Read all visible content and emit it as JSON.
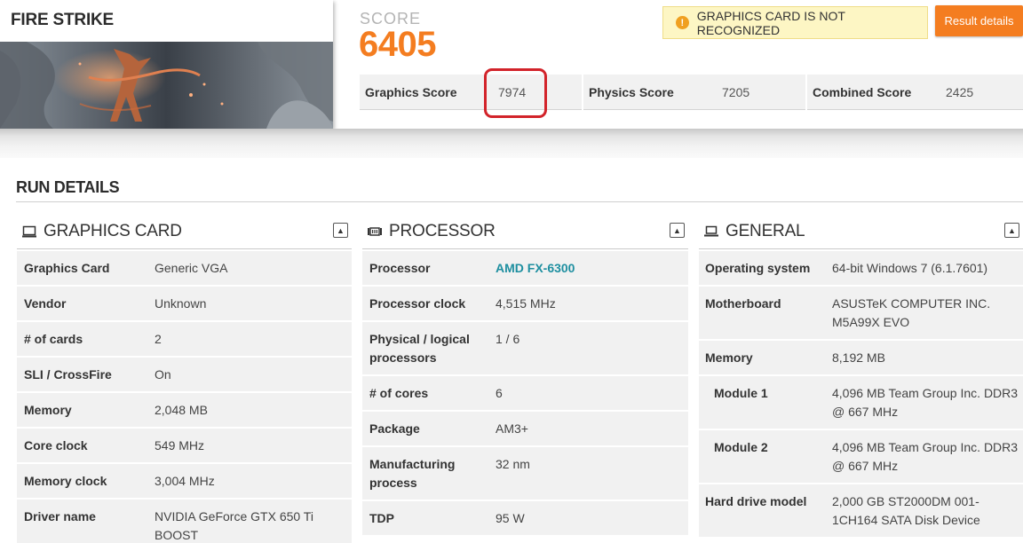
{
  "benchmark": {
    "title": "FIRE STRIKE"
  },
  "score": {
    "label": "SCORE",
    "value": "6405"
  },
  "warning": {
    "icon": "exclamation-icon",
    "text": "GRAPHICS CARD IS NOT RECOGNIZED"
  },
  "result_button": {
    "label": "Result details"
  },
  "subscores": [
    {
      "label": "Graphics Score",
      "value": "7974"
    },
    {
      "label": "Physics Score",
      "value": "7205"
    },
    {
      "label": "Combined Score",
      "value": "2425"
    }
  ],
  "run_details": {
    "title": "RUN DETAILS"
  },
  "panels": {
    "graphics": {
      "icon": "monitor-icon",
      "title": "GRAPHICS CARD",
      "rows": [
        {
          "k": "Graphics Card",
          "v": "Generic VGA"
        },
        {
          "k": "Vendor",
          "v": "Unknown"
        },
        {
          "k": "# of cards",
          "v": "2"
        },
        {
          "k": "SLI / CrossFire",
          "v": "On"
        },
        {
          "k": "Memory",
          "v": "2,048 MB"
        },
        {
          "k": "Core clock",
          "v": "549 MHz"
        },
        {
          "k": "Memory clock",
          "v": "3,004 MHz"
        },
        {
          "k": "Driver name",
          "v": "NVIDIA GeForce GTX 650 Ti BOOST"
        }
      ]
    },
    "processor": {
      "icon": "cpu-chip-icon",
      "title": "PROCESSOR",
      "rows": [
        {
          "k": "Processor",
          "v": "AMD FX-6300"
        },
        {
          "k": "Processor clock",
          "v": "4,515 MHz"
        },
        {
          "k": "Physical / logical processors",
          "v": "1 / 6"
        },
        {
          "k": "# of cores",
          "v": "6"
        },
        {
          "k": "Package",
          "v": "AM3+"
        },
        {
          "k": "Manufacturing process",
          "v": "32 nm"
        },
        {
          "k": "TDP",
          "v": "95 W"
        }
      ]
    },
    "general": {
      "icon": "laptop-icon",
      "title": "GENERAL",
      "rows": [
        {
          "k": "Operating system",
          "v": "64-bit Windows 7 (6.1.7601)"
        },
        {
          "k": "Motherboard",
          "v": "ASUSTeK COMPUTER INC. M5A99X EVO"
        },
        {
          "k": "Memory",
          "v": "8,192 MB"
        },
        {
          "k": "Module 1",
          "v": "4,096 MB Team Group Inc. DDR3 @ 667 MHz"
        },
        {
          "k": "Module 2",
          "v": "4,096 MB Team Group Inc. DDR3 @ 667 MHz"
        },
        {
          "k": "Hard drive model",
          "v": "2,000 GB ST2000DM 001-1CH164 SATA Disk Device"
        }
      ]
    }
  },
  "colors": {
    "accent": "#f47d20",
    "highlight": "#d2232a",
    "link": "#1e8fa0",
    "warning_bg": "#fdf6c4"
  }
}
